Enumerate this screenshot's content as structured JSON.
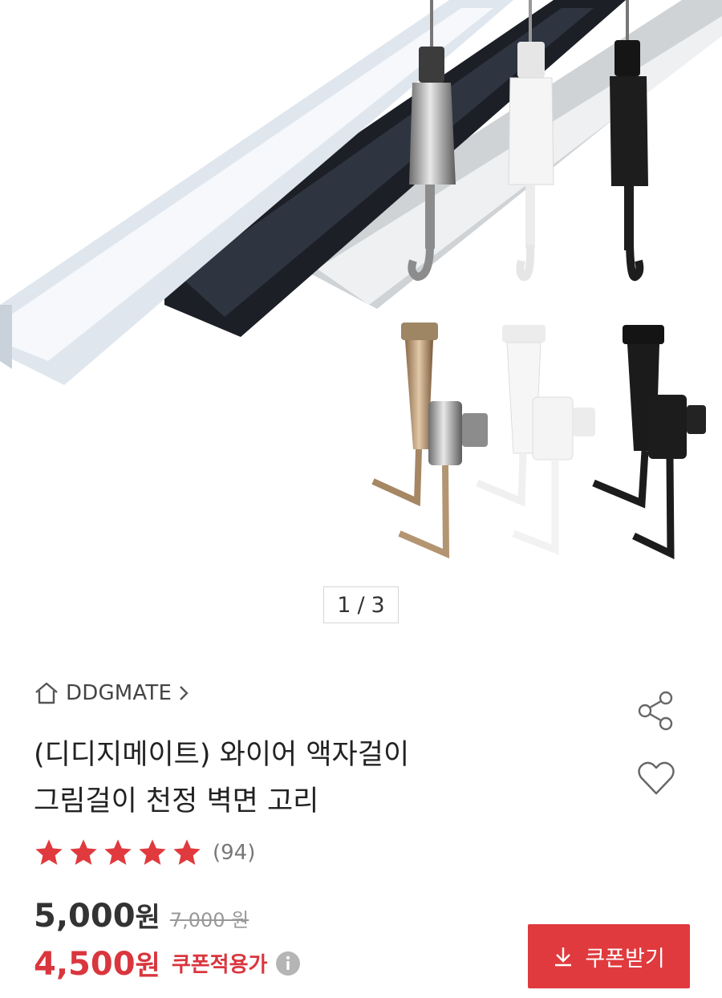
{
  "gallery": {
    "current_page": "1",
    "separator": "/",
    "total_pages": "3"
  },
  "brand": {
    "name": "DDGMATE",
    "icon": "home-icon"
  },
  "product": {
    "title_line1": "(디디지메이트) 와이어 액자걸이",
    "title_line2": "그림걸이 천정 벽면 고리",
    "rating_value": 5,
    "rating_max": 5,
    "review_count": "(94)"
  },
  "pricing": {
    "sale_price": "5,000",
    "unit": "원",
    "original_price": "7,000 원",
    "coupon_price": "4,500",
    "coupon_label": "쿠폰적용가"
  },
  "actions": {
    "coupon_button_label": "쿠폰받기",
    "share_icon": "share-icon",
    "like_icon": "heart-icon"
  },
  "colors": {
    "accent": "#e03a3e",
    "star": "#e03a3e",
    "coupon_text": "#d9363e"
  }
}
